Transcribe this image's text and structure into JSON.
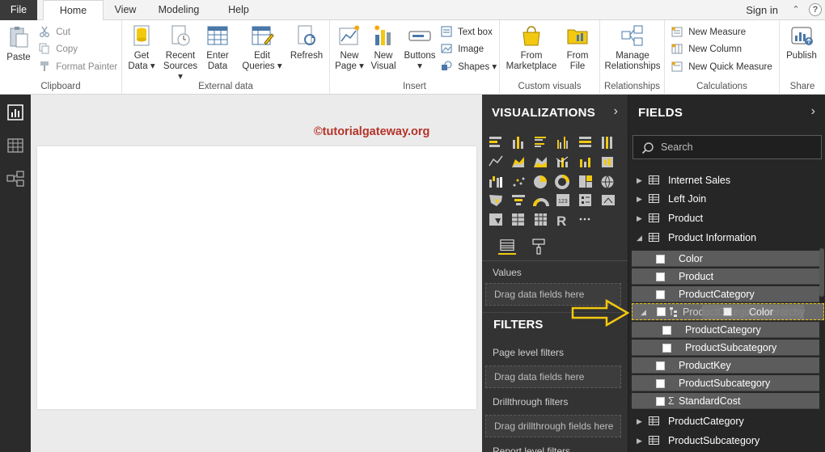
{
  "tabs": [
    "File",
    "Home",
    "View",
    "Modeling",
    "Help"
  ],
  "signin": "Sign in",
  "ribbon": {
    "clipboard": {
      "label": "Clipboard",
      "paste": "Paste",
      "cut": "Cut",
      "copy": "Copy",
      "format_painter": "Format Painter"
    },
    "external_data": {
      "label": "External data",
      "get_data": [
        "Get",
        "Data ▾"
      ],
      "recent_sources": [
        "Recent",
        "Sources ▾"
      ],
      "enter_data": [
        "Enter",
        "Data"
      ],
      "edit_queries": [
        "Edit",
        "Queries ▾"
      ],
      "refresh": "Refresh"
    },
    "insert": {
      "label": "Insert",
      "new_page": [
        "New",
        "Page ▾"
      ],
      "new_visual": [
        "New",
        "Visual"
      ],
      "buttons": [
        "Buttons",
        "▾"
      ],
      "text_box": "Text box",
      "image": "Image",
      "shapes": "Shapes ▾"
    },
    "custom_visuals": {
      "label": "Custom visuals",
      "from_marketplace": [
        "From",
        "Marketplace"
      ],
      "from_file": [
        "From",
        "File"
      ]
    },
    "relationships": {
      "label": "Relationships",
      "manage": [
        "Manage",
        "Relationships"
      ]
    },
    "calculations": {
      "label": "Calculations",
      "new_measure": "New Measure",
      "new_column": "New Column",
      "new_quick_measure": "New Quick Measure"
    },
    "share": {
      "label": "Share",
      "publish": "Publish"
    }
  },
  "watermark": "©tutorialgateway.org",
  "visualizations": {
    "title": "VISUALIZATIONS",
    "values_label": "Values",
    "drag_here": "Drag data fields here",
    "filters_title": "FILTERS",
    "page_level": "Page level filters",
    "page_drag": "Drag data fields here",
    "drillthrough": "Drillthrough filters",
    "drillthrough_drag": "Drag drillthrough fields here",
    "report_level": "Report level filters"
  },
  "fields": {
    "title": "FIELDS",
    "search_placeholder": "Search",
    "tables_top": [
      "Internet Sales",
      "Left Join",
      "Product",
      "Product Information"
    ],
    "product_info_fields": [
      "Color",
      "Product",
      "ProductCategory"
    ],
    "hierarchy": {
      "label": "ProductCategory Hierarchy",
      "ghost_label": "Color",
      "children": [
        "ProductCategory",
        "ProductSubcategory"
      ]
    },
    "more_fields": [
      "ProductKey",
      "ProductSubcategory",
      "StandardCost"
    ],
    "tables_bottom": [
      "ProductCategory",
      "ProductSubcategory"
    ]
  },
  "colors": {
    "accent": "#f2c811",
    "watermark": "#b5332a",
    "dark_pane": "#333333",
    "fields_pane": "#262626"
  }
}
